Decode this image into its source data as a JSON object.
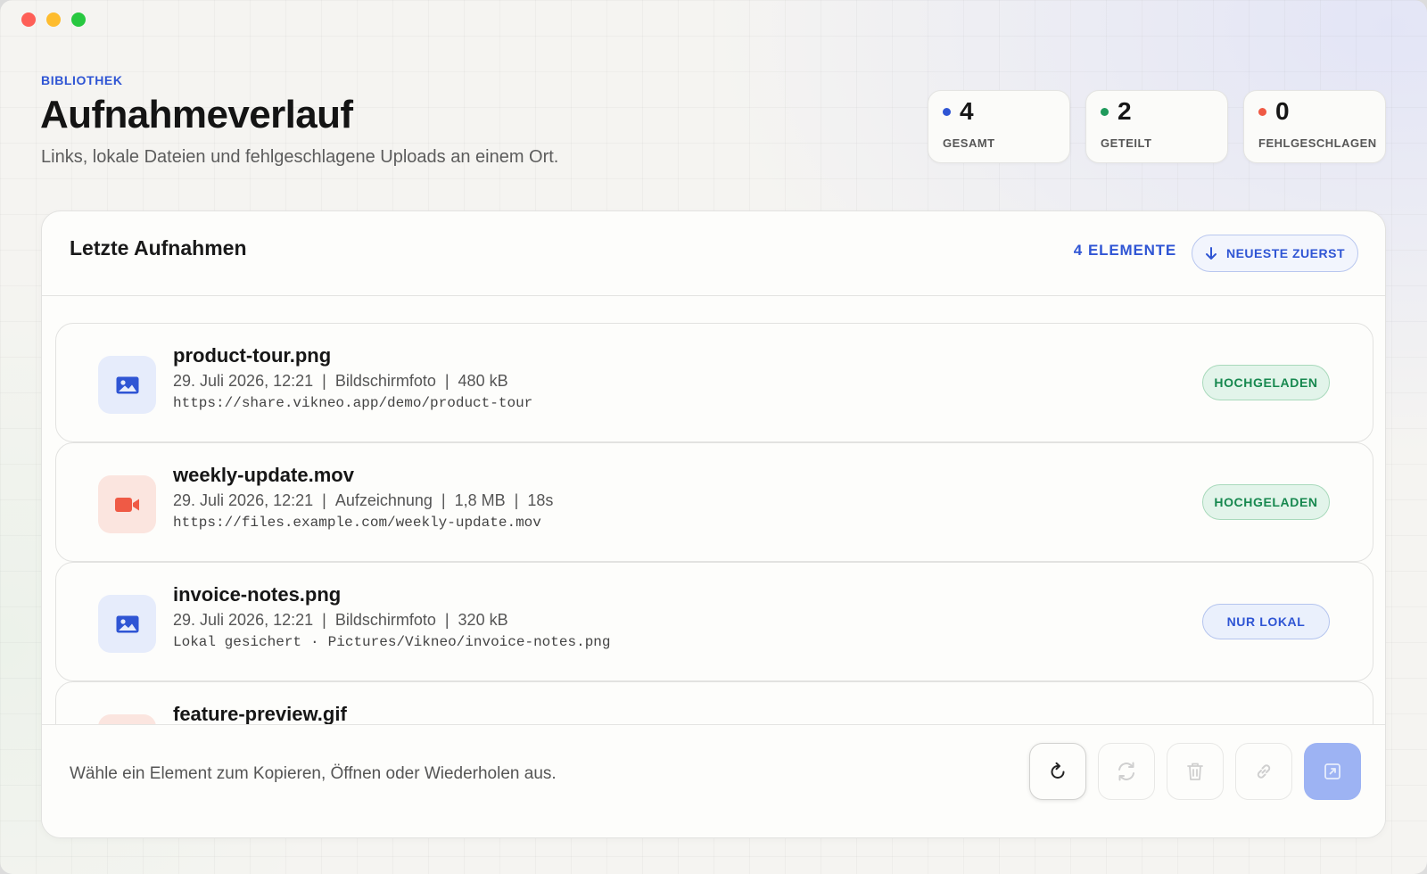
{
  "header": {
    "eyebrow": "BIBLIOTHEK",
    "title": "Aufnahmeverlauf",
    "subtitle": "Links, lokale Dateien und fehlgeschlagene Uploads an einem Ort."
  },
  "stats": [
    {
      "value": "4",
      "label": "GESAMT",
      "color": "#2f55d4"
    },
    {
      "value": "2",
      "label": "GETEILT",
      "color": "#1f9a5c"
    },
    {
      "value": "0",
      "label": "FEHLGESCHLAGEN",
      "color": "#ef5a45"
    }
  ],
  "panel": {
    "title": "Letzte Aufnahmen",
    "count_number": "4",
    "count_label": "ELEMENTE",
    "sort_label": "NEUESTE ZUERST",
    "sort_icon": "arrow-down-icon"
  },
  "items": [
    {
      "name": "product-tour.png",
      "date": "29. Juli 2026, 12:21",
      "kind": "Bildschirmfoto",
      "size": "480 kB",
      "path": "https://share.vikneo.app/demo/product-tour",
      "status": "HOCHGELADEN",
      "icon": "image-icon"
    },
    {
      "name": "weekly-update.mov",
      "date": "29. Juli 2026, 12:21",
      "kind": "Aufzeichnung",
      "size": "1,8 MB",
      "duration": "18s",
      "path": "https://files.example.com/weekly-update.mov",
      "status": "HOCHGELADEN",
      "icon": "video-camera-icon"
    },
    {
      "name": "invoice-notes.png",
      "date": "29. Juli 2026, 12:21",
      "kind": "Bildschirmfoto",
      "size": "320 kB",
      "path_prefix": "Lokal gesichert",
      "path_separator": "·",
      "path": "Pictures/Vikneo/invoice-notes.png",
      "status": "NUR LOKAL",
      "icon": "image-icon"
    },
    {
      "name": "feature-preview.gif",
      "icon": "video-camera-icon"
    }
  ],
  "footer": {
    "hint": "Wähle ein Element zum Kopieren, Öffnen oder Wiederholen aus.",
    "actions": [
      "refresh-icon",
      "retry-icon",
      "trash-icon",
      "link-icon",
      "open-external-icon"
    ]
  },
  "colors": {
    "accent": "#2f55d4",
    "success": "#1f9a5c",
    "danger": "#ef5a45",
    "primary_button": "#9db3f3"
  }
}
